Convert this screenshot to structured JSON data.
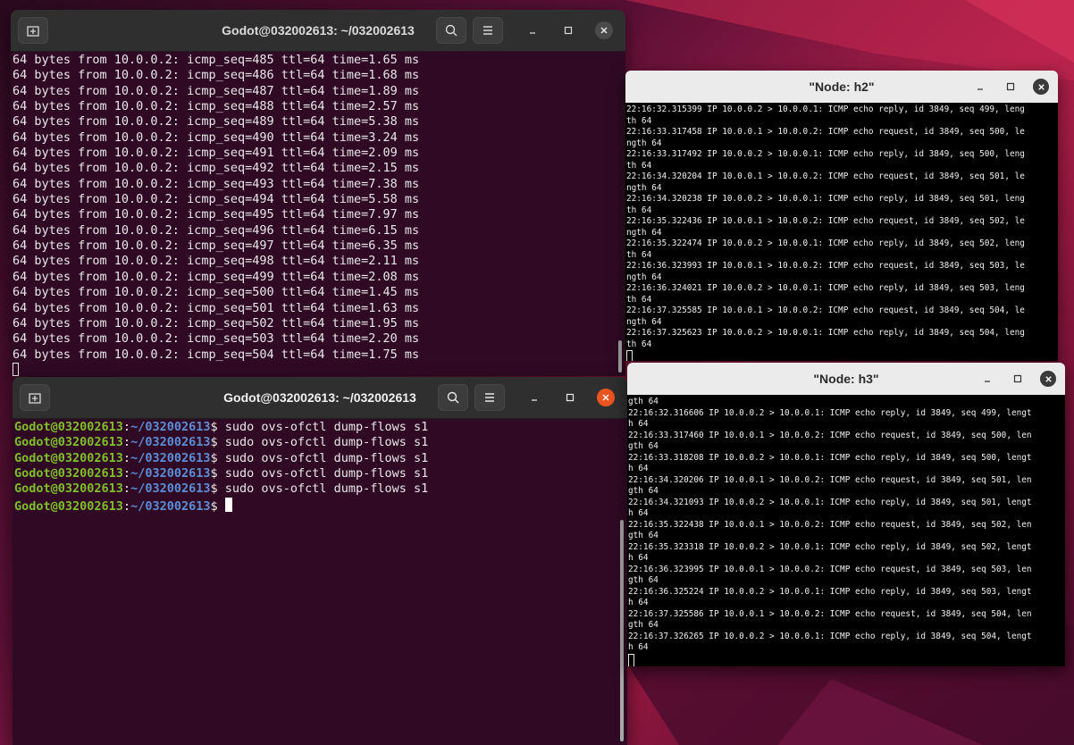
{
  "window_top": {
    "title": "Godot@032002613: ~/032002613",
    "lines": [
      "64 bytes from 10.0.0.2: icmp_seq=485 ttl=64 time=1.65 ms",
      "64 bytes from 10.0.0.2: icmp_seq=486 ttl=64 time=1.68 ms",
      "64 bytes from 10.0.0.2: icmp_seq=487 ttl=64 time=1.89 ms",
      "64 bytes from 10.0.0.2: icmp_seq=488 ttl=64 time=2.57 ms",
      "64 bytes from 10.0.0.2: icmp_seq=489 ttl=64 time=5.38 ms",
      "64 bytes from 10.0.0.2: icmp_seq=490 ttl=64 time=3.24 ms",
      "64 bytes from 10.0.0.2: icmp_seq=491 ttl=64 time=2.09 ms",
      "64 bytes from 10.0.0.2: icmp_seq=492 ttl=64 time=2.15 ms",
      "64 bytes from 10.0.0.2: icmp_seq=493 ttl=64 time=7.38 ms",
      "64 bytes from 10.0.0.2: icmp_seq=494 ttl=64 time=5.58 ms",
      "64 bytes from 10.0.0.2: icmp_seq=495 ttl=64 time=7.97 ms",
      "64 bytes from 10.0.0.2: icmp_seq=496 ttl=64 time=6.15 ms",
      "64 bytes from 10.0.0.2: icmp_seq=497 ttl=64 time=6.35 ms",
      "64 bytes from 10.0.0.2: icmp_seq=498 ttl=64 time=2.11 ms",
      "64 bytes from 10.0.0.2: icmp_seq=499 ttl=64 time=2.08 ms",
      "64 bytes from 10.0.0.2: icmp_seq=500 ttl=64 time=1.45 ms",
      "64 bytes from 10.0.0.2: icmp_seq=501 ttl=64 time=1.63 ms",
      "64 bytes from 10.0.0.2: icmp_seq=502 ttl=64 time=1.95 ms",
      "64 bytes from 10.0.0.2: icmp_seq=503 ttl=64 time=2.20 ms",
      "64 bytes from 10.0.0.2: icmp_seq=504 ttl=64 time=1.75 ms"
    ]
  },
  "window_bottom": {
    "title": "Godot@032002613: ~/032002613",
    "prompt_user": "Godot@032002613",
    "prompt_sep": ":",
    "prompt_path": "~/032002613",
    "prompt_dollar": "$",
    "commands": [
      " sudo ovs-ofctl dump-flows s1",
      " sudo ovs-ofctl dump-flows s1",
      " sudo ovs-ofctl dump-flows s1",
      " sudo ovs-ofctl dump-flows s1",
      " sudo ovs-ofctl dump-flows s1",
      " "
    ]
  },
  "node_h2": {
    "title": "\"Node: h2\"",
    "lines": [
      "22:16:32.315399 IP 10.0.0.2 > 10.0.0.1: ICMP echo reply, id 3849, seq 499, leng",
      "th 64",
      "22:16:33.317458 IP 10.0.0.1 > 10.0.0.2: ICMP echo request, id 3849, seq 500, le",
      "ngth 64",
      "22:16:33.317492 IP 10.0.0.2 > 10.0.0.1: ICMP echo reply, id 3849, seq 500, leng",
      "th 64",
      "22:16:34.320204 IP 10.0.0.1 > 10.0.0.2: ICMP echo request, id 3849, seq 501, le",
      "ngth 64",
      "22:16:34.320238 IP 10.0.0.2 > 10.0.0.1: ICMP echo reply, id 3849, seq 501, leng",
      "th 64",
      "22:16:35.322436 IP 10.0.0.1 > 10.0.0.2: ICMP echo request, id 3849, seq 502, le",
      "ngth 64",
      "22:16:35.322474 IP 10.0.0.2 > 10.0.0.1: ICMP echo reply, id 3849, seq 502, leng",
      "th 64",
      "22:16:36.323993 IP 10.0.0.1 > 10.0.0.2: ICMP echo request, id 3849, seq 503, le",
      "ngth 64",
      "22:16:36.324021 IP 10.0.0.2 > 10.0.0.1: ICMP echo reply, id 3849, seq 503, leng",
      "th 64",
      "22:16:37.325585 IP 10.0.0.1 > 10.0.0.2: ICMP echo request, id 3849, seq 504, le",
      "ngth 64",
      "22:16:37.325623 IP 10.0.0.2 > 10.0.0.1: ICMP echo reply, id 3849, seq 504, leng",
      "th 64"
    ]
  },
  "node_h3": {
    "title": "\"Node: h3\"",
    "lines": [
      "gth 64",
      "22:16:32.316606 IP 10.0.0.2 > 10.0.0.1: ICMP echo reply, id 3849, seq 499, lengt",
      "h 64",
      "22:16:33.317460 IP 10.0.0.1 > 10.0.0.2: ICMP echo request, id 3849, seq 500, len",
      "gth 64",
      "22:16:33.318208 IP 10.0.0.2 > 10.0.0.1: ICMP echo reply, id 3849, seq 500, lengt",
      "h 64",
      "22:16:34.320206 IP 10.0.0.1 > 10.0.0.2: ICMP echo request, id 3849, seq 501, len",
      "gth 64",
      "22:16:34.321093 IP 10.0.0.2 > 10.0.0.1: ICMP echo reply, id 3849, seq 501, lengt",
      "h 64",
      "22:16:35.322438 IP 10.0.0.1 > 10.0.0.2: ICMP echo request, id 3849, seq 502, len",
      "gth 64",
      "22:16:35.323318 IP 10.0.0.2 > 10.0.0.1: ICMP echo reply, id 3849, seq 502, lengt",
      "h 64",
      "22:16:36.323995 IP 10.0.0.1 > 10.0.0.2: ICMP echo request, id 3849, seq 503, len",
      "gth 64",
      "22:16:36.325224 IP 10.0.0.2 > 10.0.0.1: ICMP echo reply, id 3849, seq 503, lengt",
      "h 64",
      "22:16:37.325586 IP 10.0.0.1 > 10.0.0.2: ICMP echo request, id 3849, seq 504, len",
      "gth 64",
      "22:16:37.326265 IP 10.0.0.2 > 10.0.0.1: ICMP echo reply, id 3849, seq 504, lengt",
      "h 64"
    ]
  },
  "icons": {
    "new_tab": "new-tab-icon",
    "search": "search-icon",
    "menu": "hamburger-menu-icon",
    "minimize": "minimize-icon",
    "maximize": "maximize-icon",
    "close": "close-icon"
  },
  "colors": {
    "terminal_bg": "#300a24",
    "prompt_user": "#7fbf2a",
    "prompt_path": "#5a8fd8",
    "close_active": "#e95420"
  }
}
